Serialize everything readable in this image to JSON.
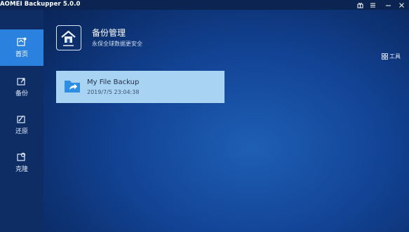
{
  "window": {
    "title": "AOMEI Backupper 5.0.0",
    "controls": [
      "gift-icon",
      "menu-icon",
      "minimize-icon",
      "close-icon"
    ]
  },
  "sidebar": {
    "items": [
      {
        "label": "首页",
        "icon": "home-icon",
        "active": true
      },
      {
        "label": "备份",
        "icon": "backup-icon",
        "active": false
      },
      {
        "label": "还原",
        "icon": "restore-icon",
        "active": false
      },
      {
        "label": "克隆",
        "icon": "clone-icon",
        "active": false
      }
    ]
  },
  "header": {
    "icon": "house-monitor-icon",
    "title": "备份管理",
    "subtitle": "永保全球数据更安全"
  },
  "toolbar": {
    "tools_label": "工具",
    "tools_icon": "grid-icon"
  },
  "backups": [
    {
      "name": "My File Backup",
      "time": "2019/7/5 23:04:38",
      "icon": "folder-share-icon"
    }
  ],
  "colors": {
    "accent": "#2a82de",
    "card": "#a9d3f3",
    "sidebar": "#0d2d64"
  }
}
